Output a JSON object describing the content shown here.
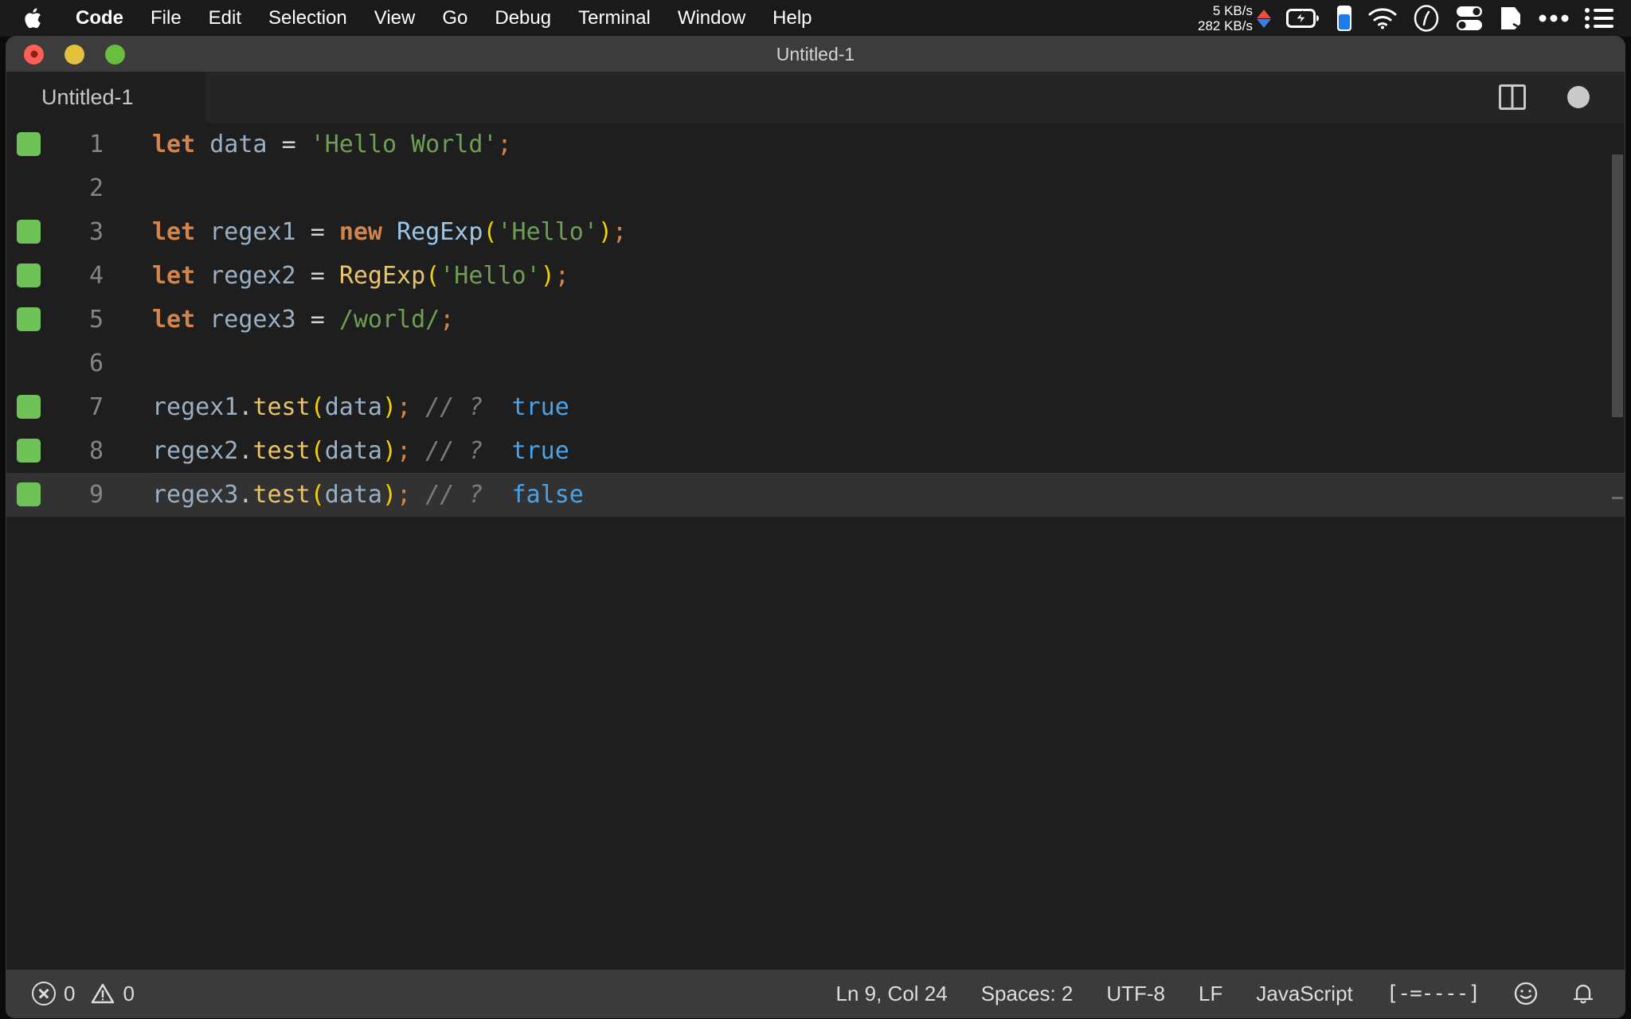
{
  "menubar": {
    "apple_icon": "apple-logo",
    "items": [
      {
        "label": "Code",
        "bold": true
      },
      {
        "label": "File",
        "bold": false
      },
      {
        "label": "Edit",
        "bold": false
      },
      {
        "label": "Selection",
        "bold": false
      },
      {
        "label": "View",
        "bold": false
      },
      {
        "label": "Go",
        "bold": false
      },
      {
        "label": "Debug",
        "bold": false
      },
      {
        "label": "Terminal",
        "bold": false
      },
      {
        "label": "Window",
        "bold": false
      },
      {
        "label": "Help",
        "bold": false
      }
    ],
    "status_items": {
      "net_up": "5 KB/s",
      "net_down": "282 KB/s",
      "icons": [
        "upload-arrow-icon",
        "download-arrow-icon",
        "battery-charging-icon",
        "memory-gauge-icon",
        "wifi-icon",
        "clock-icon",
        "toggles-icon",
        "bookmark-icon",
        "ellipsis-icon",
        "control-center-list-icon"
      ]
    }
  },
  "window": {
    "title": "Untitled-1",
    "traffic_lights": [
      "close-button",
      "minimize-button",
      "zoom-button"
    ]
  },
  "tabbar": {
    "tabs": [
      {
        "label": "Untitled-1",
        "active": true
      }
    ],
    "actions": [
      "split-editor-icon",
      "unsaved-dot-icon"
    ]
  },
  "editor": {
    "lines": [
      {
        "number": "1",
        "marked": true,
        "active": false,
        "tokens": [
          {
            "text": "let",
            "cls": "t-key"
          },
          {
            "text": " ",
            "cls": "t-plain"
          },
          {
            "text": "data",
            "cls": "t-var"
          },
          {
            "text": " ",
            "cls": "t-plain"
          },
          {
            "text": "=",
            "cls": "t-op"
          },
          {
            "text": " ",
            "cls": "t-plain"
          },
          {
            "text": "'Hello World'",
            "cls": "t-str"
          },
          {
            "text": ";",
            "cls": "t-semi"
          }
        ]
      },
      {
        "number": "2",
        "marked": false,
        "active": false,
        "tokens": []
      },
      {
        "number": "3",
        "marked": true,
        "active": false,
        "tokens": [
          {
            "text": "let",
            "cls": "t-key"
          },
          {
            "text": " ",
            "cls": "t-plain"
          },
          {
            "text": "regex1",
            "cls": "t-var"
          },
          {
            "text": " ",
            "cls": "t-plain"
          },
          {
            "text": "=",
            "cls": "t-op"
          },
          {
            "text": " ",
            "cls": "t-plain"
          },
          {
            "text": "new",
            "cls": "t-key"
          },
          {
            "text": " ",
            "cls": "t-plain"
          },
          {
            "text": "RegExp",
            "cls": "t-fnblue"
          },
          {
            "text": "(",
            "cls": "t-paren"
          },
          {
            "text": "'Hello'",
            "cls": "t-str"
          },
          {
            "text": ")",
            "cls": "t-paren"
          },
          {
            "text": ";",
            "cls": "t-semi"
          }
        ]
      },
      {
        "number": "4",
        "marked": true,
        "active": false,
        "tokens": [
          {
            "text": "let",
            "cls": "t-key"
          },
          {
            "text": " ",
            "cls": "t-plain"
          },
          {
            "text": "regex2",
            "cls": "t-var"
          },
          {
            "text": " ",
            "cls": "t-plain"
          },
          {
            "text": "=",
            "cls": "t-op"
          },
          {
            "text": " ",
            "cls": "t-plain"
          },
          {
            "text": "RegExp",
            "cls": "t-fn"
          },
          {
            "text": "(",
            "cls": "t-paren"
          },
          {
            "text": "'Hello'",
            "cls": "t-str"
          },
          {
            "text": ")",
            "cls": "t-paren"
          },
          {
            "text": ";",
            "cls": "t-semi"
          }
        ]
      },
      {
        "number": "5",
        "marked": true,
        "active": false,
        "tokens": [
          {
            "text": "let",
            "cls": "t-key"
          },
          {
            "text": " ",
            "cls": "t-plain"
          },
          {
            "text": "regex3",
            "cls": "t-var"
          },
          {
            "text": " ",
            "cls": "t-plain"
          },
          {
            "text": "=",
            "cls": "t-op"
          },
          {
            "text": " ",
            "cls": "t-plain"
          },
          {
            "text": "/world/",
            "cls": "t-str"
          },
          {
            "text": ";",
            "cls": "t-semi"
          }
        ]
      },
      {
        "number": "6",
        "marked": false,
        "active": false,
        "tokens": []
      },
      {
        "number": "7",
        "marked": true,
        "active": false,
        "tokens": [
          {
            "text": "regex1",
            "cls": "t-var"
          },
          {
            "text": ".",
            "cls": "t-plain"
          },
          {
            "text": "test",
            "cls": "t-fn"
          },
          {
            "text": "(",
            "cls": "t-paren"
          },
          {
            "text": "data",
            "cls": "t-var"
          },
          {
            "text": ")",
            "cls": "t-paren"
          },
          {
            "text": ";",
            "cls": "t-semi"
          },
          {
            "text": " ",
            "cls": "t-plain"
          },
          {
            "text": "// ?",
            "cls": "t-cmt"
          },
          {
            "text": "  ",
            "cls": "t-plain"
          },
          {
            "text": "true",
            "cls": "t-val"
          }
        ]
      },
      {
        "number": "8",
        "marked": true,
        "active": false,
        "tokens": [
          {
            "text": "regex2",
            "cls": "t-var"
          },
          {
            "text": ".",
            "cls": "t-plain"
          },
          {
            "text": "test",
            "cls": "t-fn"
          },
          {
            "text": "(",
            "cls": "t-paren"
          },
          {
            "text": "data",
            "cls": "t-var"
          },
          {
            "text": ")",
            "cls": "t-paren"
          },
          {
            "text": ";",
            "cls": "t-semi"
          },
          {
            "text": " ",
            "cls": "t-plain"
          },
          {
            "text": "// ?",
            "cls": "t-cmt"
          },
          {
            "text": "  ",
            "cls": "t-plain"
          },
          {
            "text": "true",
            "cls": "t-val"
          }
        ]
      },
      {
        "number": "9",
        "marked": true,
        "active": true,
        "tokens": [
          {
            "text": "regex3",
            "cls": "t-var"
          },
          {
            "text": ".",
            "cls": "t-plain"
          },
          {
            "text": "test",
            "cls": "t-fn"
          },
          {
            "text": "(",
            "cls": "t-paren"
          },
          {
            "text": "data",
            "cls": "t-var"
          },
          {
            "text": ")",
            "cls": "t-paren"
          },
          {
            "text": ";",
            "cls": "t-semi"
          },
          {
            "text": " ",
            "cls": "t-plain"
          },
          {
            "text": "// ?",
            "cls": "t-cmt"
          },
          {
            "text": "  ",
            "cls": "t-plain"
          },
          {
            "text": "false",
            "cls": "t-val"
          }
        ]
      }
    ]
  },
  "statusbar": {
    "errors": "0",
    "warnings": "0",
    "cursor": "Ln 9, Col 24",
    "indentation": "Spaces: 2",
    "encoding": "UTF-8",
    "eol": "LF",
    "language": "JavaScript",
    "quokka": "[-=----]",
    "feedback_icon": "smiley-icon",
    "notifications_icon": "bell-icon"
  },
  "colors": {
    "editor_bg": "#1e1e1e",
    "chrome_bg": "#252526",
    "titlebar_bg": "#3c3c3c",
    "statusbar_bg": "#3b3b3b",
    "breakpoint_green": "#6fc257",
    "keyword_orange": "#d2844a",
    "string_green": "#6f9e55",
    "function_yellow": "#e9c46a",
    "paren_yellow": "#f2d300",
    "value_blue": "#4aa3e8",
    "comment_gray": "#7c7c7c"
  }
}
